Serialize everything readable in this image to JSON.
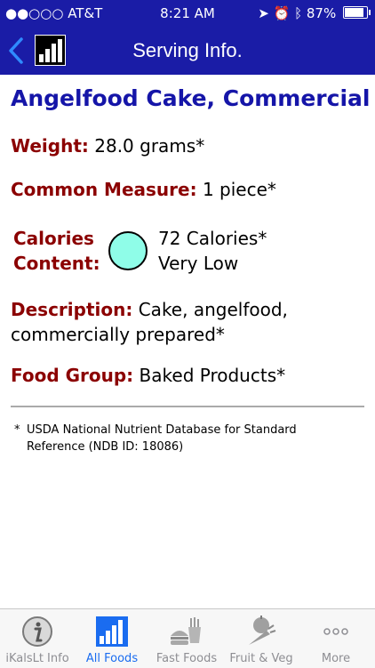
{
  "status": {
    "carrier": "●●○○○ AT&T",
    "time": "8:21 AM",
    "battery": "87%",
    "battery_level": 0.87
  },
  "nav": {
    "title": "Serving Info."
  },
  "food": {
    "name": "Angelfood Cake, Commercial",
    "weight_label": "Weight:",
    "weight_value": "28.0 grams*",
    "measure_label": "Common Measure:",
    "measure_value": "1 piece*",
    "calories_label_1": "Calories",
    "calories_label_2": "Content:",
    "calories_value": "72 Calories*",
    "calories_level": "Very Low",
    "calories_color": "#8ffde8",
    "description_label": "Description:",
    "description_value": "Cake, angelfood, commercially prepared*",
    "group_label": "Food Group:",
    "group_value": "Baked Products*"
  },
  "footnote": {
    "star": "*",
    "text": "USDA National Nutrient Database for Standard Reference (NDB ID: 18086)"
  },
  "tabs": [
    {
      "label": "iKalsLt Info",
      "icon": "info-icon"
    },
    {
      "label": "All Foods",
      "icon": "bar-chart-icon",
      "active": true
    },
    {
      "label": "Fast Foods",
      "icon": "fast-food-icon"
    },
    {
      "label": "Fruit & Veg",
      "icon": "fruit-veg-icon"
    },
    {
      "label": "More",
      "icon": "more-icon"
    }
  ],
  "colors": {
    "nav_bg": "#1a1ca6",
    "title": "#1515a8",
    "label": "#8b0000",
    "tab_active": "#1a6cf0"
  }
}
